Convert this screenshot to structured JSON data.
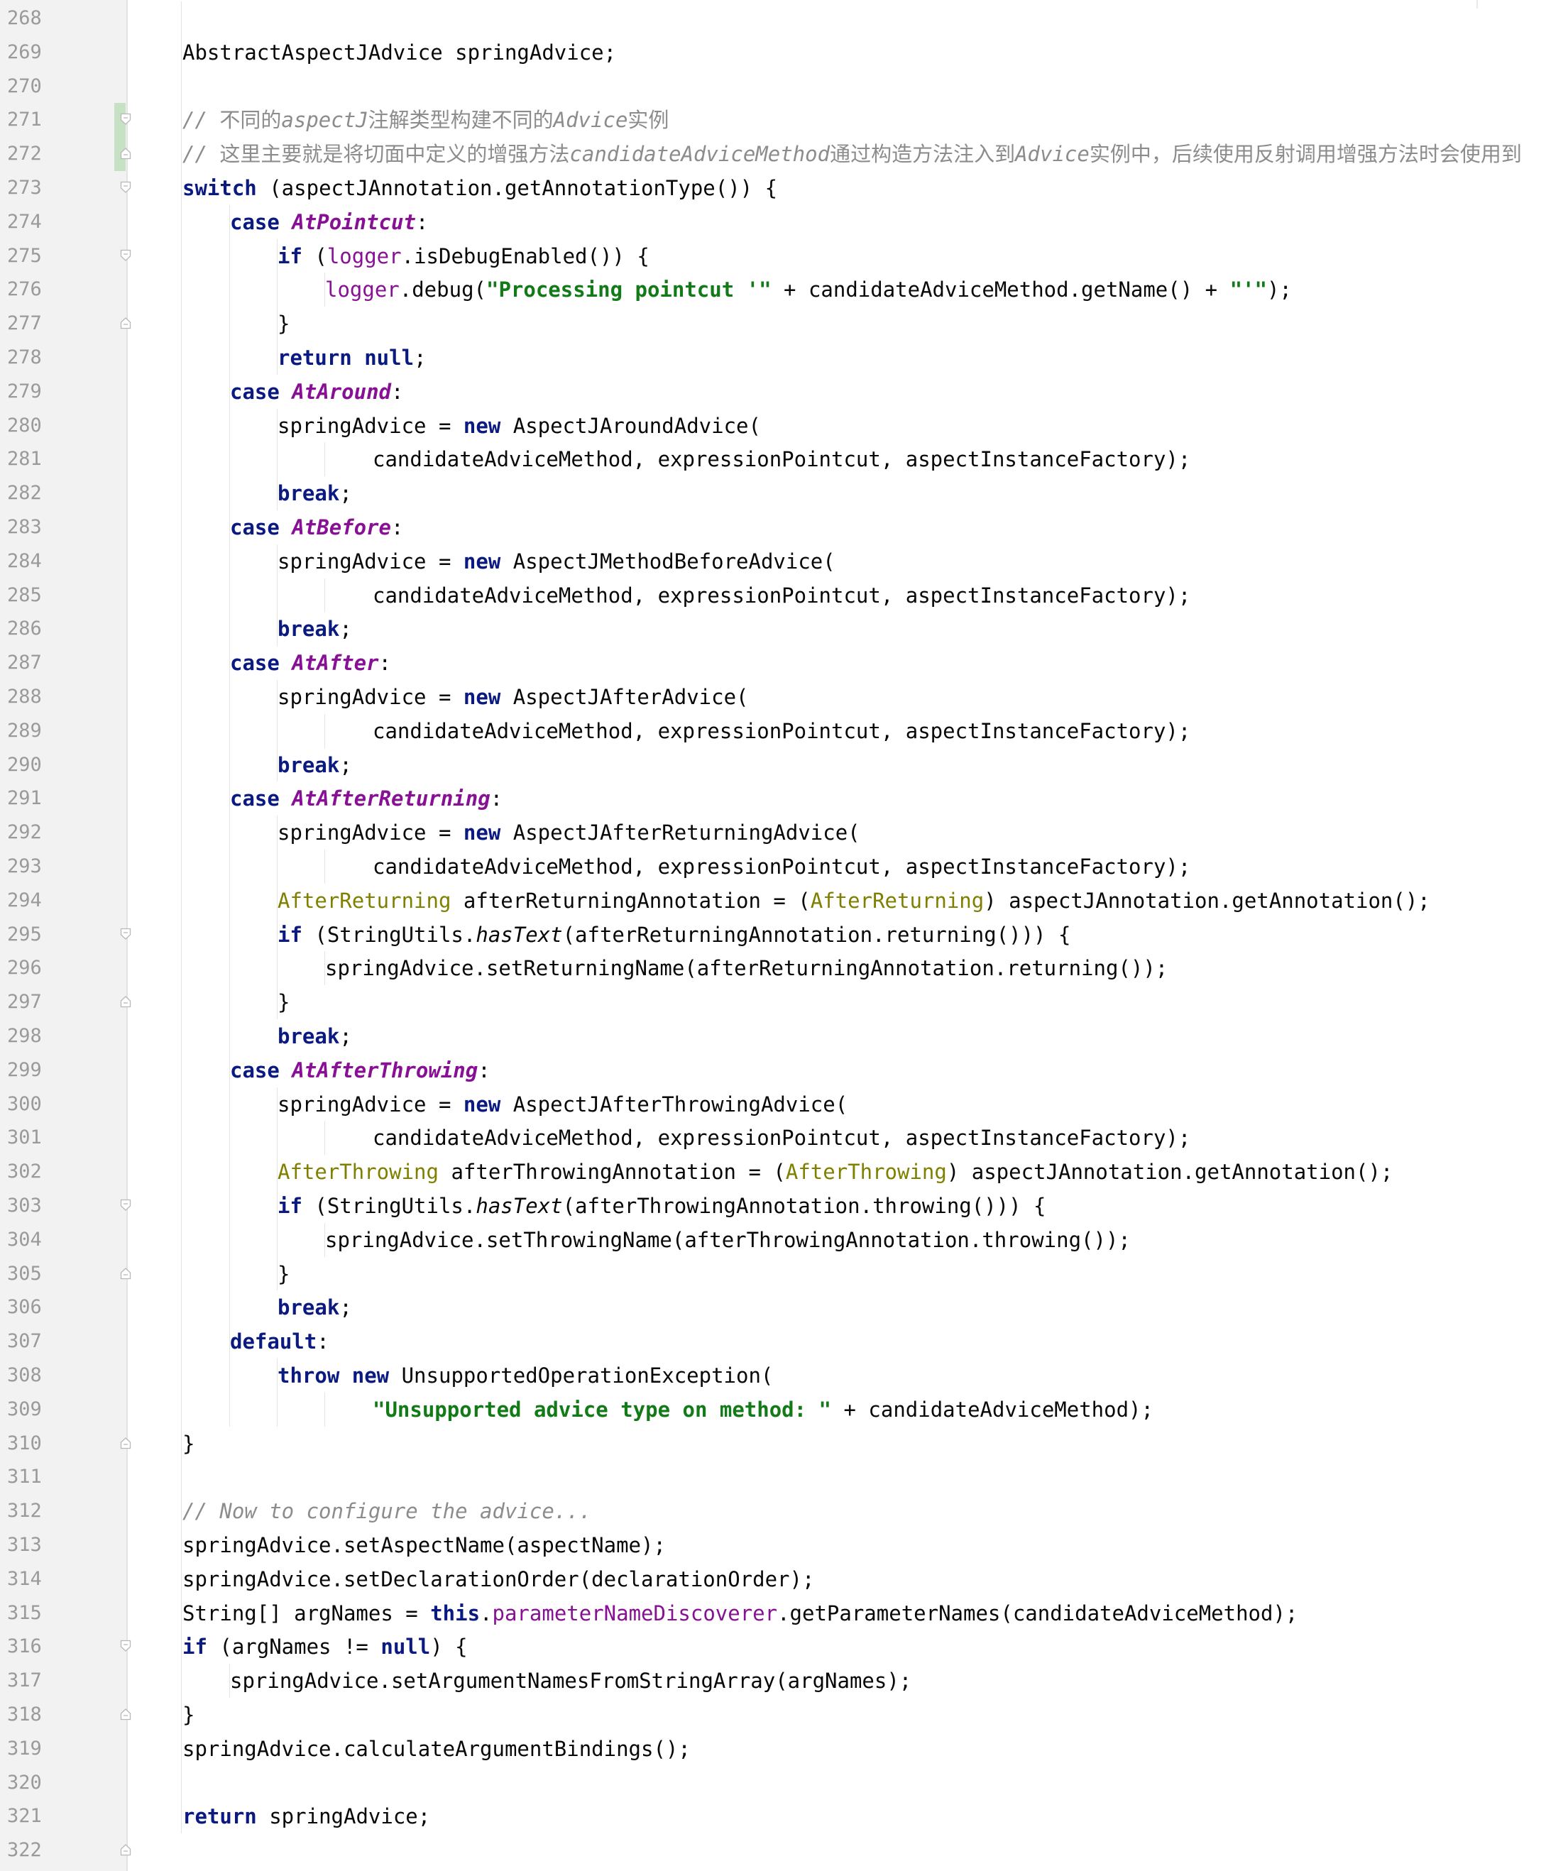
{
  "editor": {
    "colors": {
      "gutter_bg": "#f2f2f2",
      "line_number": "#9a9a9a",
      "keyword": "#0a1a80",
      "string": "#137a18",
      "comment": "#8c8c8c",
      "enum_constant": "#871094",
      "annotation_type": "#808000",
      "vcs_changed": "#c6e1c3"
    },
    "lines": [
      {
        "n": "268",
        "indent": 0,
        "tokens": []
      },
      {
        "n": "269",
        "indent": 1,
        "tokens": [
          {
            "t": "AbstractAspectJAdvice springAdvice;",
            "c": "plain"
          }
        ]
      },
      {
        "n": "270",
        "indent": 0,
        "tokens": []
      },
      {
        "n": "271",
        "indent": 1,
        "fold": "start",
        "changed": true,
        "tokens": [
          {
            "t": "// ",
            "c": "comment"
          },
          {
            "t": "不同的",
            "c": "comment-cn"
          },
          {
            "t": "aspectJ",
            "c": "comment"
          },
          {
            "t": "注解类型构建不同的",
            "c": "comment-cn"
          },
          {
            "t": "Advice",
            "c": "comment"
          },
          {
            "t": "实例",
            "c": "comment-cn"
          }
        ]
      },
      {
        "n": "272",
        "indent": 1,
        "fold": "end",
        "changed": true,
        "tokens": [
          {
            "t": "// ",
            "c": "comment"
          },
          {
            "t": "这里主要就是将切面中定义的增强方法",
            "c": "comment-cn"
          },
          {
            "t": "candidateAdviceMethod",
            "c": "comment"
          },
          {
            "t": "通过构造方法注入到",
            "c": "comment-cn"
          },
          {
            "t": "Advice",
            "c": "comment"
          },
          {
            "t": "实例中，后续使用反射调用增强方法时会使用到",
            "c": "comment-cn"
          }
        ]
      },
      {
        "n": "273",
        "indent": 1,
        "fold": "start",
        "tokens": [
          {
            "t": "switch",
            "c": "kw"
          },
          {
            "t": " (aspectJAnnotation.getAnnotationType()) {",
            "c": "plain"
          }
        ]
      },
      {
        "n": "274",
        "indent": 2,
        "tokens": [
          {
            "t": "case ",
            "c": "kw"
          },
          {
            "t": "AtPointcut",
            "c": "label"
          },
          {
            "t": ":",
            "c": "plain"
          }
        ]
      },
      {
        "n": "275",
        "indent": 3,
        "fold": "start",
        "tokens": [
          {
            "t": "if",
            "c": "kw"
          },
          {
            "t": " (",
            "c": "plain"
          },
          {
            "t": "logger",
            "c": "field"
          },
          {
            "t": ".isDebugEnabled()) {",
            "c": "plain"
          }
        ]
      },
      {
        "n": "276",
        "indent": 4,
        "tokens": [
          {
            "t": "logger",
            "c": "field"
          },
          {
            "t": ".debug(",
            "c": "plain"
          },
          {
            "t": "\"Processing pointcut '\"",
            "c": "string"
          },
          {
            "t": " + candidateAdviceMethod.getName() + ",
            "c": "plain"
          },
          {
            "t": "\"'\"",
            "c": "string"
          },
          {
            "t": ");",
            "c": "plain"
          }
        ]
      },
      {
        "n": "277",
        "indent": 3,
        "fold": "end",
        "tokens": [
          {
            "t": "}",
            "c": "plain"
          }
        ]
      },
      {
        "n": "278",
        "indent": 3,
        "tokens": [
          {
            "t": "return null",
            "c": "kw"
          },
          {
            "t": ";",
            "c": "plain"
          }
        ]
      },
      {
        "n": "279",
        "indent": 2,
        "tokens": [
          {
            "t": "case ",
            "c": "kw"
          },
          {
            "t": "AtAround",
            "c": "label"
          },
          {
            "t": ":",
            "c": "plain"
          }
        ]
      },
      {
        "n": "280",
        "indent": 3,
        "tokens": [
          {
            "t": "springAdvice = ",
            "c": "plain"
          },
          {
            "t": "new",
            "c": "kw"
          },
          {
            "t": " AspectJAroundAdvice(",
            "c": "plain"
          }
        ]
      },
      {
        "n": "281",
        "indent": 5,
        "tokens": [
          {
            "t": "candidateAdviceMethod, expressionPointcut, aspectInstanceFactory);",
            "c": "plain"
          }
        ]
      },
      {
        "n": "282",
        "indent": 3,
        "tokens": [
          {
            "t": "break",
            "c": "kw"
          },
          {
            "t": ";",
            "c": "plain"
          }
        ]
      },
      {
        "n": "283",
        "indent": 2,
        "tokens": [
          {
            "t": "case ",
            "c": "kw"
          },
          {
            "t": "AtBefore",
            "c": "label"
          },
          {
            "t": ":",
            "c": "plain"
          }
        ]
      },
      {
        "n": "284",
        "indent": 3,
        "tokens": [
          {
            "t": "springAdvice = ",
            "c": "plain"
          },
          {
            "t": "new",
            "c": "kw"
          },
          {
            "t": " AspectJMethodBeforeAdvice(",
            "c": "plain"
          }
        ]
      },
      {
        "n": "285",
        "indent": 5,
        "tokens": [
          {
            "t": "candidateAdviceMethod, expressionPointcut, aspectInstanceFactory);",
            "c": "plain"
          }
        ]
      },
      {
        "n": "286",
        "indent": 3,
        "tokens": [
          {
            "t": "break",
            "c": "kw"
          },
          {
            "t": ";",
            "c": "plain"
          }
        ]
      },
      {
        "n": "287",
        "indent": 2,
        "tokens": [
          {
            "t": "case ",
            "c": "kw"
          },
          {
            "t": "AtAfter",
            "c": "label"
          },
          {
            "t": ":",
            "c": "plain"
          }
        ]
      },
      {
        "n": "288",
        "indent": 3,
        "tokens": [
          {
            "t": "springAdvice = ",
            "c": "plain"
          },
          {
            "t": "new",
            "c": "kw"
          },
          {
            "t": " AspectJAfterAdvice(",
            "c": "plain"
          }
        ]
      },
      {
        "n": "289",
        "indent": 5,
        "tokens": [
          {
            "t": "candidateAdviceMethod, expressionPointcut, aspectInstanceFactory);",
            "c": "plain"
          }
        ]
      },
      {
        "n": "290",
        "indent": 3,
        "tokens": [
          {
            "t": "break",
            "c": "kw"
          },
          {
            "t": ";",
            "c": "plain"
          }
        ]
      },
      {
        "n": "291",
        "indent": 2,
        "tokens": [
          {
            "t": "case ",
            "c": "kw"
          },
          {
            "t": "AtAfterReturning",
            "c": "label"
          },
          {
            "t": ":",
            "c": "plain"
          }
        ]
      },
      {
        "n": "292",
        "indent": 3,
        "tokens": [
          {
            "t": "springAdvice = ",
            "c": "plain"
          },
          {
            "t": "new",
            "c": "kw"
          },
          {
            "t": " AspectJAfterReturningAdvice(",
            "c": "plain"
          }
        ]
      },
      {
        "n": "293",
        "indent": 5,
        "tokens": [
          {
            "t": "candidateAdviceMethod, expressionPointcut, aspectInstanceFactory);",
            "c": "plain"
          }
        ]
      },
      {
        "n": "294",
        "indent": 3,
        "tokens": [
          {
            "t": "AfterReturning",
            "c": "annotype"
          },
          {
            "t": " afterReturningAnnotation = (",
            "c": "plain"
          },
          {
            "t": "AfterReturning",
            "c": "annotype"
          },
          {
            "t": ") aspectJAnnotation.getAnnotation();",
            "c": "plain"
          }
        ]
      },
      {
        "n": "295",
        "indent": 3,
        "fold": "start",
        "tokens": [
          {
            "t": "if",
            "c": "kw"
          },
          {
            "t": " (StringUtils.",
            "c": "plain"
          },
          {
            "t": "hasText",
            "c": "static"
          },
          {
            "t": "(afterReturningAnnotation.returning())) {",
            "c": "plain"
          }
        ]
      },
      {
        "n": "296",
        "indent": 4,
        "tokens": [
          {
            "t": "springAdvice.setReturningName(afterReturningAnnotation.returning());",
            "c": "plain"
          }
        ]
      },
      {
        "n": "297",
        "indent": 3,
        "fold": "end",
        "tokens": [
          {
            "t": "}",
            "c": "plain"
          }
        ]
      },
      {
        "n": "298",
        "indent": 3,
        "tokens": [
          {
            "t": "break",
            "c": "kw"
          },
          {
            "t": ";",
            "c": "plain"
          }
        ]
      },
      {
        "n": "299",
        "indent": 2,
        "tokens": [
          {
            "t": "case ",
            "c": "kw"
          },
          {
            "t": "AtAfterThrowing",
            "c": "label"
          },
          {
            "t": ":",
            "c": "plain"
          }
        ]
      },
      {
        "n": "300",
        "indent": 3,
        "tokens": [
          {
            "t": "springAdvice = ",
            "c": "plain"
          },
          {
            "t": "new",
            "c": "kw"
          },
          {
            "t": " AspectJAfterThrowingAdvice(",
            "c": "plain"
          }
        ]
      },
      {
        "n": "301",
        "indent": 5,
        "tokens": [
          {
            "t": "candidateAdviceMethod, expressionPointcut, aspectInstanceFactory);",
            "c": "plain"
          }
        ]
      },
      {
        "n": "302",
        "indent": 3,
        "tokens": [
          {
            "t": "AfterThrowing",
            "c": "annotype"
          },
          {
            "t": " afterThrowingAnnotation = (",
            "c": "plain"
          },
          {
            "t": "AfterThrowing",
            "c": "annotype"
          },
          {
            "t": ") aspectJAnnotation.getAnnotation();",
            "c": "plain"
          }
        ]
      },
      {
        "n": "303",
        "indent": 3,
        "fold": "start",
        "tokens": [
          {
            "t": "if",
            "c": "kw"
          },
          {
            "t": " (StringUtils.",
            "c": "plain"
          },
          {
            "t": "hasText",
            "c": "static"
          },
          {
            "t": "(afterThrowingAnnotation.throwing())) {",
            "c": "plain"
          }
        ]
      },
      {
        "n": "304",
        "indent": 4,
        "tokens": [
          {
            "t": "springAdvice.setThrowingName(afterThrowingAnnotation.throwing());",
            "c": "plain"
          }
        ]
      },
      {
        "n": "305",
        "indent": 3,
        "fold": "end",
        "tokens": [
          {
            "t": "}",
            "c": "plain"
          }
        ]
      },
      {
        "n": "306",
        "indent": 3,
        "tokens": [
          {
            "t": "break",
            "c": "kw"
          },
          {
            "t": ";",
            "c": "plain"
          }
        ]
      },
      {
        "n": "307",
        "indent": 2,
        "tokens": [
          {
            "t": "default",
            "c": "kw"
          },
          {
            "t": ":",
            "c": "plain"
          }
        ]
      },
      {
        "n": "308",
        "indent": 3,
        "tokens": [
          {
            "t": "throw new",
            "c": "kw"
          },
          {
            "t": " UnsupportedOperationException(",
            "c": "plain"
          }
        ]
      },
      {
        "n": "309",
        "indent": 5,
        "tokens": [
          {
            "t": "\"Unsupported advice type on method: \"",
            "c": "string"
          },
          {
            "t": " + candidateAdviceMethod);",
            "c": "plain"
          }
        ]
      },
      {
        "n": "310",
        "indent": 1,
        "fold": "end",
        "tokens": [
          {
            "t": "}",
            "c": "plain"
          }
        ]
      },
      {
        "n": "311",
        "indent": 0,
        "tokens": []
      },
      {
        "n": "312",
        "indent": 1,
        "tokens": [
          {
            "t": "// Now to configure the advice...",
            "c": "comment"
          }
        ]
      },
      {
        "n": "313",
        "indent": 1,
        "tokens": [
          {
            "t": "springAdvice.setAspectName(aspectName);",
            "c": "plain"
          }
        ]
      },
      {
        "n": "314",
        "indent": 1,
        "tokens": [
          {
            "t": "springAdvice.setDeclarationOrder(declarationOrder);",
            "c": "plain"
          }
        ]
      },
      {
        "n": "315",
        "indent": 1,
        "tokens": [
          {
            "t": "String[] argNames = ",
            "c": "plain"
          },
          {
            "t": "this",
            "c": "kw"
          },
          {
            "t": ".",
            "c": "plain"
          },
          {
            "t": "parameterNameDiscoverer",
            "c": "field"
          },
          {
            "t": ".getParameterNames(candidateAdviceMethod);",
            "c": "plain"
          }
        ]
      },
      {
        "n": "316",
        "indent": 1,
        "fold": "start",
        "tokens": [
          {
            "t": "if",
            "c": "kw"
          },
          {
            "t": " (argNames != ",
            "c": "plain"
          },
          {
            "t": "null",
            "c": "kw"
          },
          {
            "t": ") {",
            "c": "plain"
          }
        ]
      },
      {
        "n": "317",
        "indent": 2,
        "tokens": [
          {
            "t": "springAdvice.setArgumentNamesFromStringArray(argNames);",
            "c": "plain"
          }
        ]
      },
      {
        "n": "318",
        "indent": 1,
        "fold": "end",
        "tokens": [
          {
            "t": "}",
            "c": "plain"
          }
        ]
      },
      {
        "n": "319",
        "indent": 1,
        "tokens": [
          {
            "t": "springAdvice.calculateArgumentBindings();",
            "c": "plain"
          }
        ]
      },
      {
        "n": "320",
        "indent": 0,
        "tokens": []
      },
      {
        "n": "321",
        "indent": 1,
        "tokens": [
          {
            "t": "return",
            "c": "kw"
          },
          {
            "t": " springAdvice;",
            "c": "plain"
          }
        ]
      },
      {
        "n": "322",
        "indent": 0,
        "fold": "end",
        "tokens": [
          {
            "t": "}",
            "c": "plain"
          }
        ]
      }
    ]
  }
}
